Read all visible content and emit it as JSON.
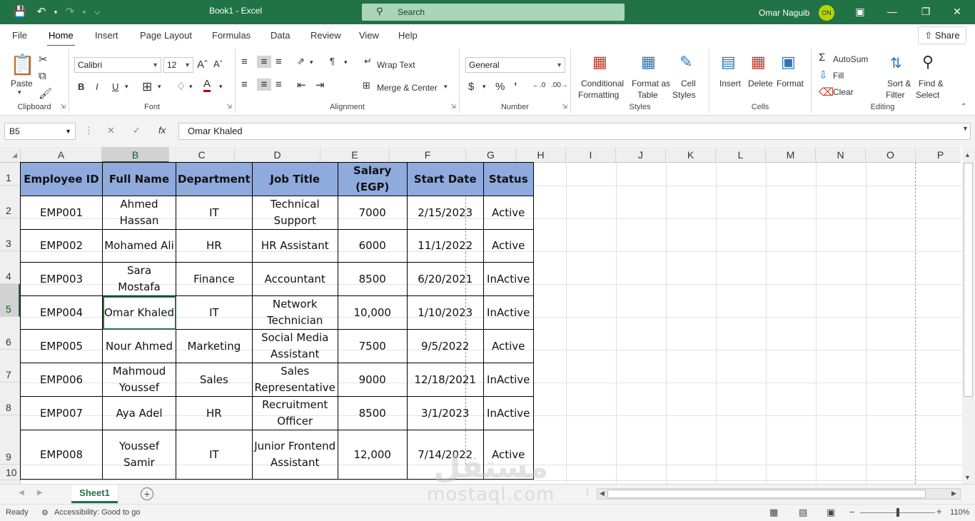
{
  "titlebar": {
    "title": "Book1  -  Excel",
    "search_label": "Search",
    "user_name": "Omar Naguib",
    "user_initials": "ON"
  },
  "menu": {
    "tabs": [
      "File",
      "Home",
      "Insert",
      "Page Layout",
      "Formulas",
      "Data",
      "Review",
      "View",
      "Help"
    ],
    "share_label": "Share"
  },
  "ribbon": {
    "clipboard": {
      "label": "Clipboard",
      "paste": "Paste"
    },
    "font": {
      "label": "Font",
      "name": "Calibri",
      "size": "12"
    },
    "alignment": {
      "label": "Alignment",
      "wrap_text": "Wrap Text",
      "merge_center": "Merge & Center"
    },
    "number": {
      "label": "Number",
      "format": "General"
    },
    "styles": {
      "label": "Styles",
      "cond1": "Conditional",
      "cond2": "Formatting",
      "fmt1": "Format as",
      "fmt2": "Table",
      "cell1": "Cell",
      "cell2": "Styles"
    },
    "cells": {
      "label": "Cells",
      "insert": "Insert",
      "delete": "Delete",
      "format": "Format"
    },
    "editing": {
      "label": "Editing",
      "autosum": "AutoSum",
      "fill": "Fill",
      "clear": "Clear",
      "sort1": "Sort &",
      "sort2": "Filter",
      "find1": "Find &",
      "find2": "Select"
    }
  },
  "formula_bar": {
    "name_box": "B5",
    "value": "Omar Khaled"
  },
  "grid": {
    "columns": [
      "A",
      "B",
      "C",
      "D",
      "E",
      "F",
      "G",
      "H",
      "I",
      "J",
      "K",
      "L",
      "M",
      "N",
      "O",
      "P"
    ],
    "rows": [
      "1",
      "2",
      "3",
      "4",
      "5",
      "6",
      "7",
      "8",
      "9",
      "10"
    ],
    "headers": [
      "Employee ID",
      "Full Name",
      "Department",
      "Job Title",
      "Salary (EGP)",
      "Start Date",
      "Status"
    ],
    "records": [
      {
        "id": "EMP001",
        "name": "Ahmed Hassan",
        "dept": "IT",
        "title": "Technical Support",
        "salary": "7000",
        "start": "2/15/2023",
        "status": "Active"
      },
      {
        "id": "EMP002",
        "name": "Mohamed Ali",
        "dept": "HR",
        "title": "HR Assistant",
        "salary": "6000",
        "start": "11/1/2022",
        "status": "Active"
      },
      {
        "id": "EMP003",
        "name": "Sara Mostafa",
        "dept": "Finance",
        "title": "Accountant",
        "salary": "8500",
        "start": "6/20/2021",
        "status": "InActive"
      },
      {
        "id": "EMP004",
        "name": "Omar Khaled",
        "dept": "IT",
        "title": "Network Technician",
        "salary": "10,000",
        "start": "1/10/2023",
        "status": "InActive"
      },
      {
        "id": "EMP005",
        "name": "Nour Ahmed",
        "dept": "Marketing",
        "title": "Social Media Assistant",
        "salary": "7500",
        "start": "9/5/2022",
        "status": "Active"
      },
      {
        "id": "EMP006",
        "name": "Mahmoud Youssef",
        "dept": "Sales",
        "title": "Sales Representative",
        "salary": "9000",
        "start": "12/18/2021",
        "status": "InActive"
      },
      {
        "id": "EMP007",
        "name": "Aya Adel",
        "dept": "HR",
        "title": "Recruitment Officer",
        "salary": "8500",
        "start": "3/1/2023",
        "status": "InActive"
      },
      {
        "id": "EMP008",
        "name": "Youssef Samir",
        "dept": "IT",
        "title": "Junior Frontend Assistant",
        "salary": "12,000",
        "start": "7/14/2022",
        "status": "Active"
      }
    ]
  },
  "sheets": {
    "active": "Sheet1"
  },
  "status": {
    "ready": "Ready",
    "accessibility": "Accessibility: Good to go",
    "zoom": "110%"
  },
  "watermark": {
    "arabic": "مستقل",
    "latin": "mostaql.com"
  },
  "colors": {
    "excel_green": "#217346",
    "header_fill": "#8faadc"
  }
}
